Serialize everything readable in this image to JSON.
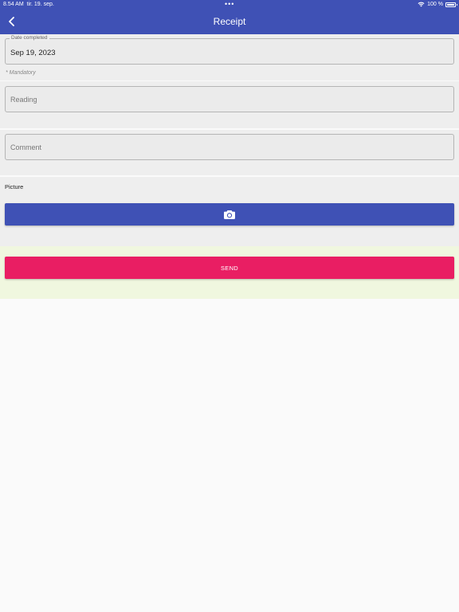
{
  "status_bar": {
    "time": "8.54 AM",
    "date": "tir. 19. sep.",
    "dots": "•••",
    "battery": "100 %"
  },
  "app_bar": {
    "title": "Receipt",
    "back_icon": "chevron-left-icon"
  },
  "form": {
    "date_completed": {
      "label": "Date completed",
      "value": "Sep 19, 2023"
    },
    "mandatory_note": "* Mandatory",
    "reading": {
      "placeholder": "Reading",
      "value": ""
    },
    "comment": {
      "placeholder": "Comment",
      "value": ""
    },
    "picture": {
      "label": "Picture",
      "button_icon": "camera-icon"
    },
    "send_label": "SEND"
  },
  "colors": {
    "primary": "#3f51b5",
    "accent": "#e91e63",
    "send_area_bg": "#f0f7df",
    "form_bg": "#eeeeee",
    "page_bg": "#fafafa"
  }
}
